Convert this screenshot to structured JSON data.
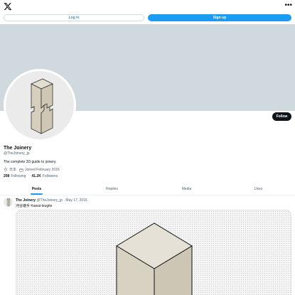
{
  "header": {
    "logo_icon": "x-logo-icon",
    "more_icon": "more-dots-icon",
    "more_glyph": "•••",
    "login_label": "Log in",
    "signup_label": "Sign up"
  },
  "profile": {
    "name": "The Joinery",
    "handle": "@TheJoinery_jp",
    "bio": "The complete 3D guide to joinery.",
    "location": "日本",
    "joined": "Joined February 2016",
    "following_count": "208",
    "following_label": "Following",
    "followers_count": "41.2K",
    "followers_label": "Followers",
    "follow_label": "Follow"
  },
  "tabs": [
    {
      "label": "Posts",
      "active": true
    },
    {
      "label": "Replies",
      "active": false
    },
    {
      "label": "Media",
      "active": false
    },
    {
      "label": "Likes",
      "active": false
    }
  ],
  "post": {
    "author": "The Joinery",
    "handle": "@TheJoinery_jp",
    "separator": "·",
    "date": "May 17, 2016",
    "text": "河合継手 Kawai-tsugite"
  },
  "colors": {
    "accent": "#1d9bf0",
    "banner": "#cfd9de",
    "text": "#0f1419",
    "secondary": "#536471"
  }
}
